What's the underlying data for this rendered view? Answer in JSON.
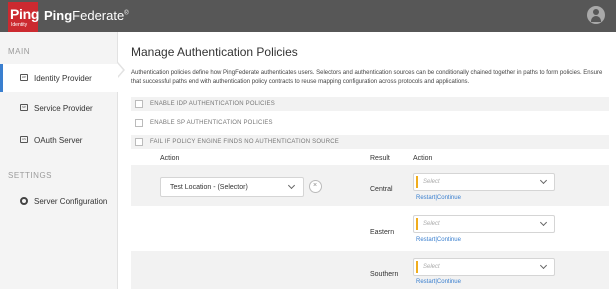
{
  "header": {
    "logo_text": "Ping",
    "logo_subtext": "Identity",
    "brand_bold": "Ping",
    "brand_rest": "Federate",
    "brand_mark": "®"
  },
  "sidebar": {
    "main_heading": "MAIN",
    "settings_heading": "SETTINGS",
    "items": [
      {
        "label": "Identity Provider",
        "icon": "idp-icon",
        "icon_text": "IdP",
        "active": true
      },
      {
        "label": "Service Provider",
        "icon": "sp-icon",
        "icon_text": "SP",
        "active": false
      },
      {
        "label": "OAuth Server",
        "icon": "oauth-icon",
        "icon_text": "AS",
        "active": false
      }
    ],
    "settings_items": [
      {
        "label": "Server Configuration",
        "icon": "gear-icon"
      }
    ]
  },
  "main": {
    "title": "Manage Authentication Policies",
    "description": "Authentication policies define how PingFederate authenticates users. Selectors and authentication sources can be conditionally chained together in paths to form policies. Ensure that successful paths end with authentication policy contracts to reuse mapping configuration across protocols and applications.",
    "options": [
      {
        "label": "ENABLE IDP AUTHENTICATION POLICIES",
        "checked": false
      },
      {
        "label": "ENABLE SP AUTHENTICATION POLICIES",
        "checked": false
      },
      {
        "label": "FAIL IF POLICY ENGINE FINDS NO AUTHENTICATION SOURCE",
        "checked": false
      }
    ],
    "columns": {
      "action": "Action",
      "result": "Result",
      "result_action": "Action"
    },
    "selector_value": "Test Location - (Selector)",
    "remove_symbol": "×",
    "results": [
      {
        "result": "Central",
        "placeholder": "Select",
        "link_restart": "Restart",
        "separator": "|",
        "link_continue": "Continue"
      },
      {
        "result": "Eastern",
        "placeholder": "Select",
        "link_restart": "Restart",
        "separator": "|",
        "link_continue": "Continue"
      },
      {
        "result": "Southern",
        "placeholder": "Select",
        "link_restart": "Restart",
        "separator": "|",
        "link_continue": "Continue"
      }
    ]
  },
  "colors": {
    "topbar": "#575757",
    "brand_red": "#cc2a30",
    "accent_blue": "#3a7fcf",
    "required_marker": "#f0ad1e"
  }
}
